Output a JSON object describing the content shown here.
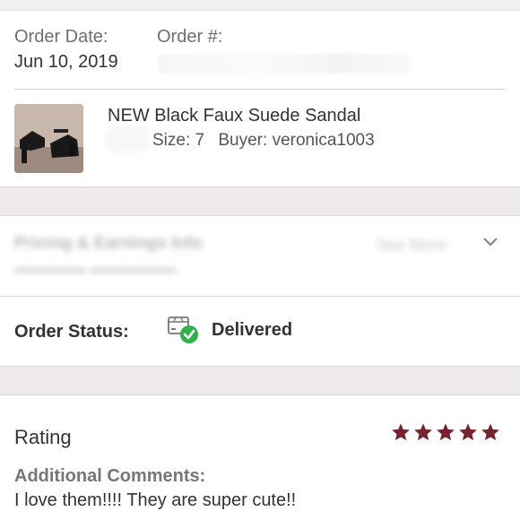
{
  "order": {
    "date_label": "Order Date:",
    "date_value": "Jun 10, 2019",
    "number_label": "Order #:"
  },
  "item": {
    "title": "NEW Black Faux Suede Sandal",
    "size": "Size: 7",
    "buyer": "Buyer: veronica1003"
  },
  "pricing": {
    "title": "Pricing & Earnings Info",
    "more": "See More"
  },
  "status": {
    "label": "Order Status:",
    "value": "Delivered",
    "icon": "delivered-box-check-icon",
    "check_color": "#2eb24b"
  },
  "rating": {
    "label": "Rating",
    "stars": 5,
    "star_color": "#7a2130",
    "comments_label": "Additional Comments:",
    "comments_text": "I love them!!!! They are super cute!!"
  }
}
